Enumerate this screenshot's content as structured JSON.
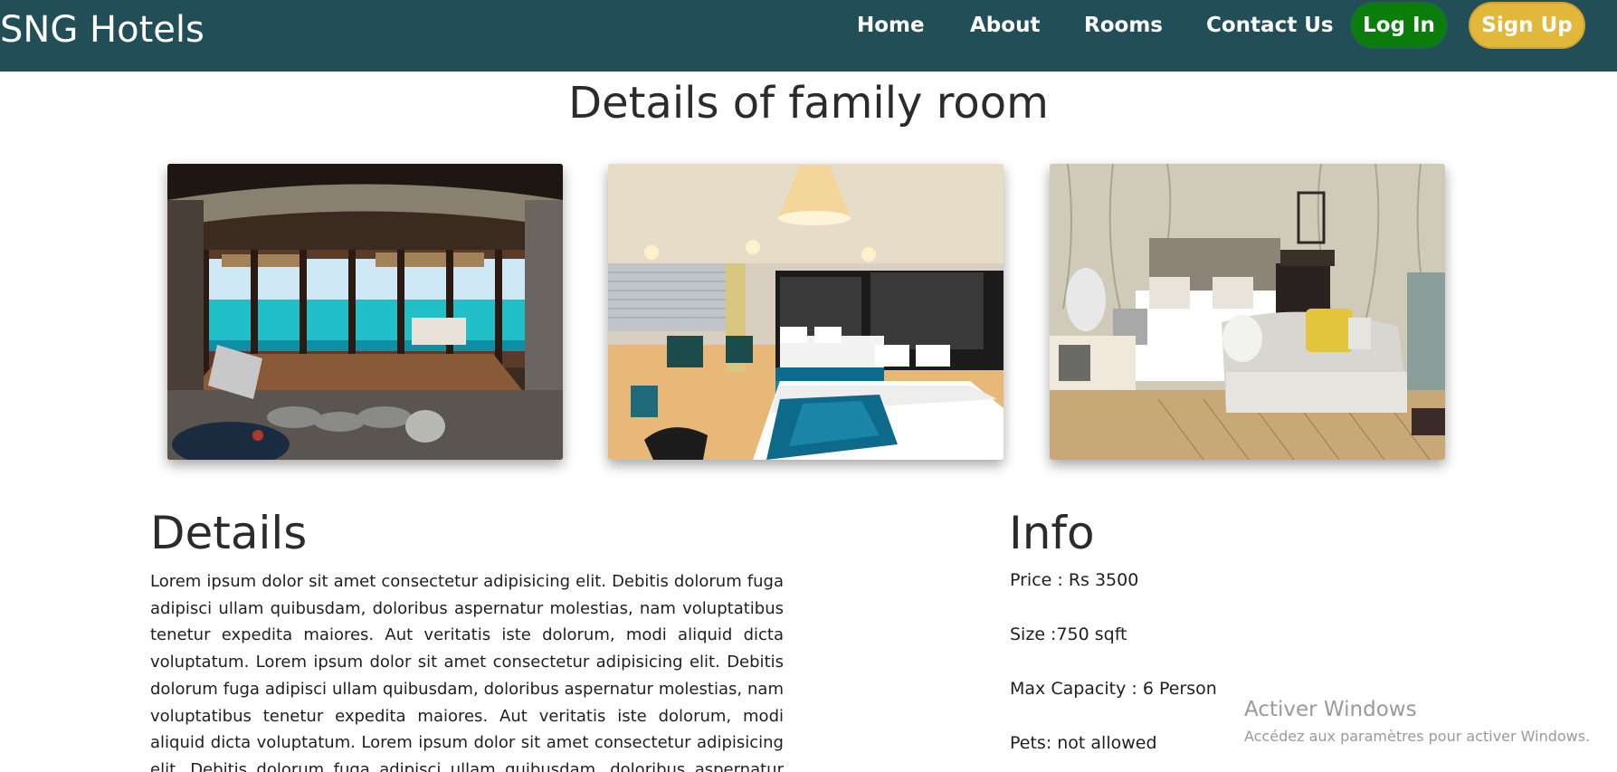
{
  "navbar": {
    "brand": "SNG Hotels",
    "links": [
      "Home",
      "About",
      "Rooms",
      "Contact Us"
    ],
    "login_label": "Log In",
    "signup_label": "Sign Up",
    "colors": {
      "background": "#224f57",
      "login": "#0a7d0a",
      "signup": "#e2b83a"
    }
  },
  "main": {
    "title": "Details of family room",
    "photos": [
      "room-photo-overwater-villa",
      "room-photo-twin-beds",
      "room-photo-bedroom-with-sofa"
    ],
    "details": {
      "heading": "Details",
      "text": "Lorem ipsum dolor sit amet consectetur adipisicing elit. Debitis dolorum fuga adipisci ullam quibusdam, doloribus aspernatur molestias, nam voluptatibus tenetur expedita maiores. Aut veritatis iste dolorum, modi aliquid dicta voluptatum. Lorem ipsum dolor sit amet consectetur adipisicing elit. Debitis dolorum fuga adipisci ullam quibusdam, doloribus aspernatur molestias, nam voluptatibus tenetur expedita maiores. Aut veritatis iste dolorum, modi aliquid dicta voluptatum. Lorem ipsum dolor sit amet consectetur adipisicing elit. Debitis dolorum fuga adipisci ullam quibusdam, doloribus aspernatur molestias, nam voluptatibus tenetur expedita maiores."
    },
    "info": {
      "heading": "Info",
      "price": "Price : Rs 3500",
      "size": "Size :750 sqft",
      "capacity": "Max Capacity : 6 Person",
      "pets": "Pets: not allowed"
    }
  },
  "watermark": {
    "title": "Activer Windows",
    "subtitle": "Accédez aux paramètres pour activer Windows."
  }
}
